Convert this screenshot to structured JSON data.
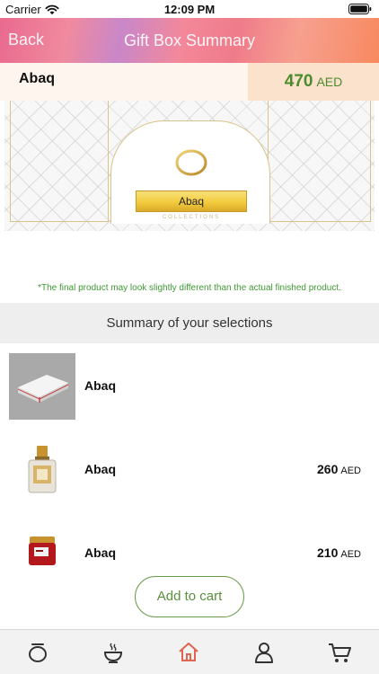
{
  "status_bar": {
    "carrier": "Carrier",
    "time": "12:09 PM"
  },
  "nav": {
    "back_label": "Back",
    "title": "Gift Box Summary"
  },
  "header_row": {
    "name": "Abaq",
    "price": "470",
    "currency": "AED"
  },
  "banner": {
    "label": "Abaq",
    "sub": "COLLECTIONS"
  },
  "disclaimer": "*The final product may look slightly different than the actual finished product.",
  "summary": {
    "title": "Summary of your selections",
    "items": [
      {
        "name": "Abaq",
        "price": "",
        "currency": "",
        "icon": "gift-box-icon"
      },
      {
        "name": "Abaq",
        "price": "260",
        "currency": "AED",
        "icon": "perfume-bottle-icon"
      },
      {
        "name": "Abaq",
        "price": "210",
        "currency": "AED",
        "icon": "incense-jar-icon"
      }
    ]
  },
  "actions": {
    "add_to_cart": "Add to cart"
  },
  "tab_bar": {
    "items": [
      {
        "icon": "ring-icon"
      },
      {
        "icon": "incense-burner-icon"
      },
      {
        "icon": "home-icon",
        "active": true
      },
      {
        "icon": "profile-icon"
      },
      {
        "icon": "cart-icon"
      }
    ]
  },
  "colors": {
    "accent_green": "#4c8b2b",
    "active_tab": "#e0644f",
    "gold": "#d9c38a"
  }
}
